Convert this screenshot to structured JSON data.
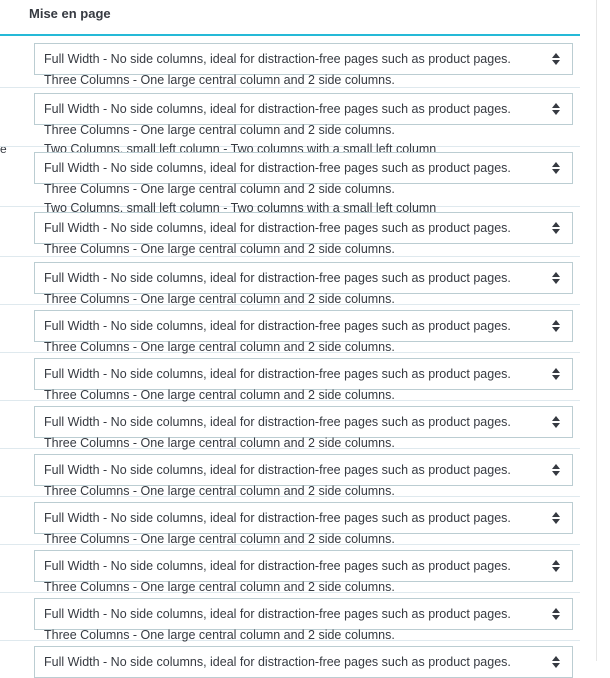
{
  "header": {
    "title": "Mise en page"
  },
  "left_cut_text": "e",
  "options": {
    "full_width": "Full Width - No side columns, ideal for distraction-free pages such as product pages.",
    "three_columns": "Three Columns - One large central column and 2 side columns.",
    "two_columns_small_left": "Two Columns, small left column - Two columns with a small left column"
  },
  "rows_count_note": "",
  "colors": {
    "accent": "#25b9d7",
    "highlighter": "#ffe600"
  }
}
